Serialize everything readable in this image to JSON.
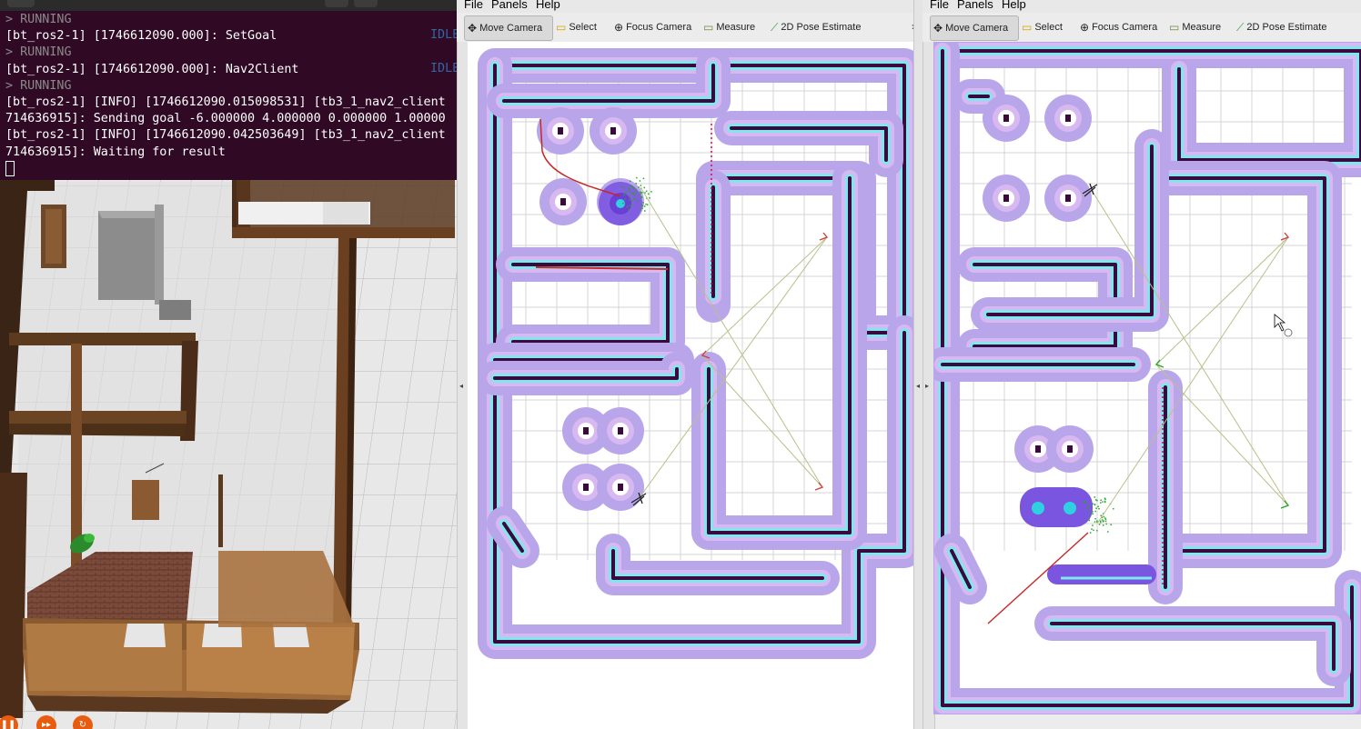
{
  "terminal": {
    "lines": [
      {
        "text": "> RUNNING",
        "kind": "run"
      },
      {
        "text": "[bt_ros2-1] [1746612090.000]: SetGoal",
        "kind": "log",
        "status": "IDLE"
      },
      {
        "text": "> RUNNING",
        "kind": "run"
      },
      {
        "text": "[bt_ros2-1] [1746612090.000]: Nav2Client",
        "kind": "log",
        "status": "IDLE"
      },
      {
        "text": "> RUNNING",
        "kind": "run"
      },
      {
        "text": "[bt_ros2-1] [INFO] [1746612090.015098531] [tb3_1_nav2_client",
        "kind": "log"
      },
      {
        "text": "714636915]: Sending goal -6.000000 4.000000 0.000000 1.00000",
        "kind": "log"
      },
      {
        "text": "[bt_ros2-1] [INFO] [1746612090.042503649] [tb3_1_nav2_client",
        "kind": "log"
      },
      {
        "text": "714636915]: Waiting for result",
        "kind": "log"
      }
    ]
  },
  "gazebo": {
    "controls": [
      {
        "name": "pause-button",
        "icon": "pause-icon",
        "glyph": "❚❚"
      },
      {
        "name": "step-button",
        "icon": "fast-forward-icon",
        "glyph": "▸▸"
      },
      {
        "name": "reset-button",
        "icon": "reset-icon",
        "glyph": "↻"
      }
    ]
  },
  "rviz_left": {
    "menu": [
      "File",
      "Panels",
      "Help"
    ],
    "tools": [
      {
        "label": "Move Camera",
        "icon": "move-camera-icon",
        "active": true
      },
      {
        "label": "Select",
        "icon": "select-icon",
        "active": false
      },
      {
        "label": "Focus Camera",
        "icon": "focus-camera-icon",
        "active": false
      },
      {
        "label": "Measure",
        "icon": "measure-icon",
        "active": false
      },
      {
        "label": "2D Pose Estimate",
        "icon": "pose-estimate-icon",
        "active": false
      }
    ],
    "overflow": "»"
  },
  "rviz_right": {
    "menu": [
      "File",
      "Panels",
      "Help"
    ],
    "tools": [
      {
        "label": "Move Camera",
        "icon": "move-camera-icon",
        "active": true
      },
      {
        "label": "Select",
        "icon": "select-icon",
        "active": false
      },
      {
        "label": "Focus Camera",
        "icon": "focus-camera-icon",
        "active": false
      },
      {
        "label": "Measure",
        "icon": "measure-icon",
        "active": false
      },
      {
        "label": "2D Pose Estimate",
        "icon": "pose-estimate-icon",
        "active": false
      }
    ]
  },
  "colors": {
    "terminal_bg": "#300a24",
    "idle": "#3465a4",
    "costmap": "#b9a6ea",
    "inflation_edge": "#7fe7ef",
    "wall": "#3a0a3c",
    "path": "#c62828",
    "robot": "#6a3fd6"
  }
}
